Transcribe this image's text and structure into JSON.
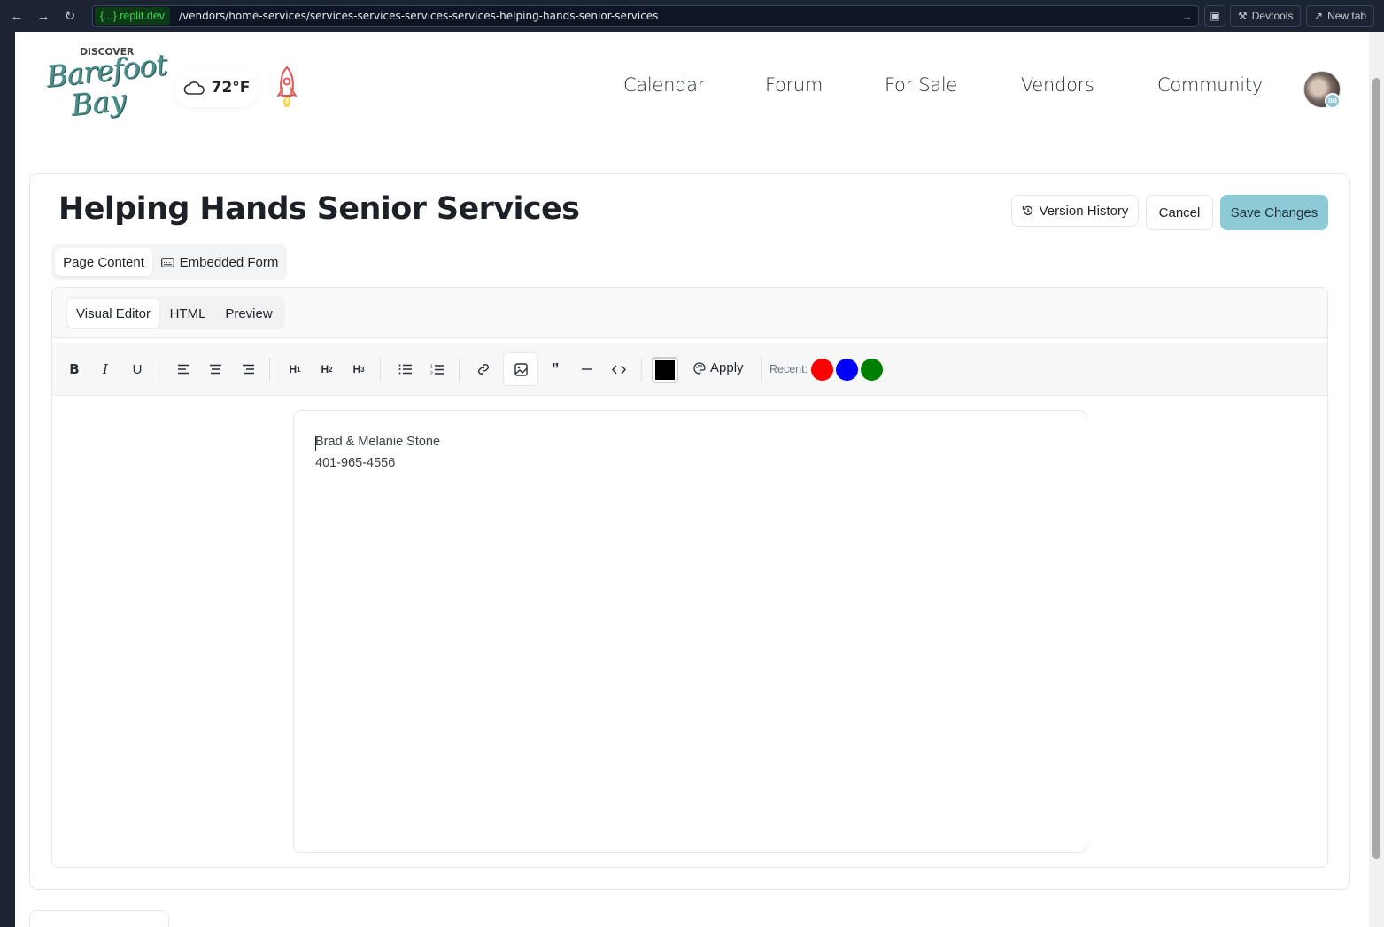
{
  "browser": {
    "domain": "{...}.replit.dev",
    "path": "/vendors/home-services/services-services-services-services-helping-hands-senior-services",
    "devtools_label": "Devtools",
    "newtab_label": "New tab"
  },
  "header": {
    "logo": {
      "top": "DISCOVER",
      "line1": "Barefoot",
      "line2": "Bay"
    },
    "weather": {
      "temp": "72°F",
      "icon": "cloud-icon"
    },
    "nav": [
      "Calendar",
      "Forum",
      "For Sale",
      "Vendors",
      "Community"
    ],
    "avatar_badge": "BB"
  },
  "page": {
    "title": "Helping Hands Senior Services",
    "actions": {
      "version_history": "Version History",
      "cancel": "Cancel",
      "save": "Save Changes"
    },
    "content_tabs": [
      "Page Content",
      "Embedded Form"
    ],
    "editor_tabs": [
      "Visual Editor",
      "HTML",
      "Preview"
    ]
  },
  "toolbar": {
    "buttons": [
      "bold-icon",
      "italic-icon",
      "underline-icon",
      "align-left-icon",
      "align-center-icon",
      "align-right-icon",
      "heading1-icon",
      "heading2-icon",
      "heading3-icon",
      "bullet-list-icon",
      "ordered-list-icon",
      "link-icon",
      "image-icon",
      "quote-icon",
      "horizontal-rule-icon",
      "code-icon"
    ],
    "current_color": "#000000",
    "apply_label": "Apply",
    "recent_label": "Recent:",
    "recent_colors": [
      "#ff0000",
      "#0000ff",
      "#008000"
    ]
  },
  "document": {
    "lines": [
      "Brad & Melanie Stone",
      "401-965-4556"
    ]
  },
  "colors": {
    "accent": "#8ecad6",
    "brand": "#4a8f8c"
  }
}
